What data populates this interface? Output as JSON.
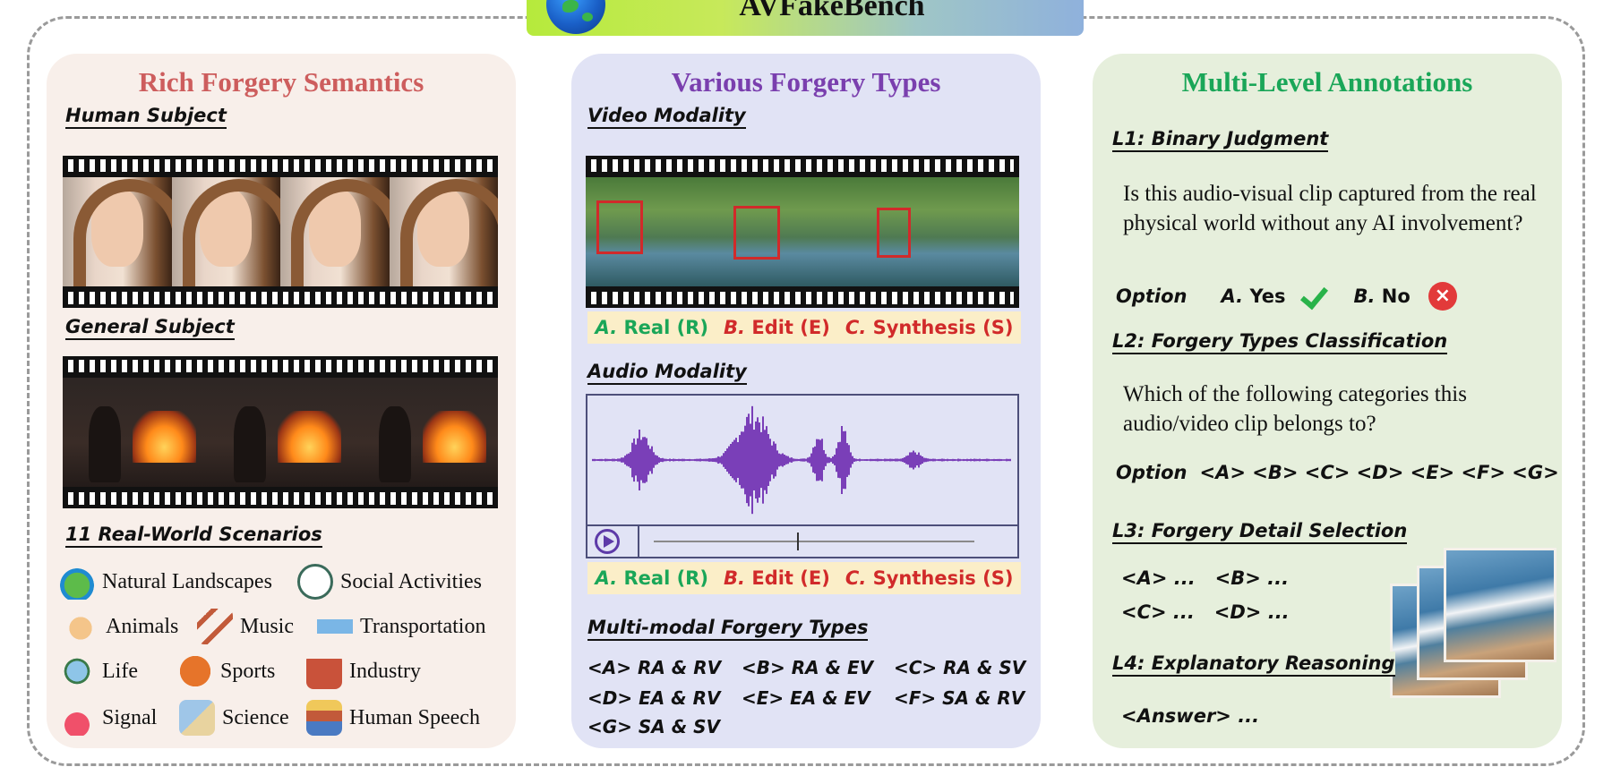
{
  "title": "AVFakeBench",
  "panels": {
    "semantics": {
      "title": "Rich Forgery Semantics",
      "human_subject": "Human Subject",
      "general_subject": "General Subject",
      "scenarios_title": "11 Real-World Scenarios",
      "scenarios": [
        {
          "label": "Natural Landscapes",
          "icon": "landscape-icon"
        },
        {
          "label": "Social Activities",
          "icon": "social-icon"
        },
        {
          "label": "Animals",
          "icon": "animal-icon"
        },
        {
          "label": "Music",
          "icon": "music-icon"
        },
        {
          "label": "Transportation",
          "icon": "transport-icon"
        },
        {
          "label": "Life",
          "icon": "life-icon"
        },
        {
          "label": "Sports",
          "icon": "sports-icon"
        },
        {
          "label": "Industry",
          "icon": "industry-icon"
        },
        {
          "label": "Signal",
          "icon": "signal-icon"
        },
        {
          "label": "Science",
          "icon": "science-icon"
        },
        {
          "label": "Human Speech",
          "icon": "speech-icon"
        }
      ]
    },
    "types": {
      "title": "Various Forgery Types",
      "video_modality": "Video Modality",
      "audio_modality": "Audio Modality",
      "options": {
        "a_letter": "A.",
        "a_text": "Real (R)",
        "b_letter": "B.",
        "b_text": "Edit (E)",
        "c_letter": "C.",
        "c_text": "Synthesis (S)"
      },
      "multimodal_title": "Multi-modal Forgery Types",
      "combos": [
        "<A> RA & RV",
        "<B> RA & EV",
        "<C> RA & SV",
        "<D> EA & RV",
        "<E> EA & EV",
        "<F> SA & RV",
        "<G> SA & SV"
      ]
    },
    "annotations": {
      "title": "Multi-Level Annotations",
      "l1_title": "L1: Binary Judgment",
      "l1_question": "Is this audio-visual clip captured from the real physical world without any AI involvement?",
      "option_label": "Option",
      "l1_a_letter": "A.",
      "l1_a_text": "Yes",
      "l1_b_letter": "B.",
      "l1_b_text": "No",
      "l1_x": "×",
      "l2_title": "L2: Forgery Types Classification",
      "l2_question": "Which of the following categories this audio/video clip belongs to?",
      "l2_options": "<A> <B> <C> <D> <E> <F> <G>",
      "l3_title": "L3: Forgery Detail Selection",
      "l3_row1": "<A> ...   <B> ...",
      "l3_row2": "<C> ...   <D> ...",
      "l4_title": "L4: Explanatory Reasoning",
      "l4_answer": "<Answer> ..."
    }
  },
  "colors": {
    "semantics_title": "#cd5d5d",
    "types_title": "#7a3fae",
    "annotations_title": "#1aa658",
    "real": "#1aa658",
    "forged": "#d12a2a",
    "waveform": "#7a3fb8"
  }
}
